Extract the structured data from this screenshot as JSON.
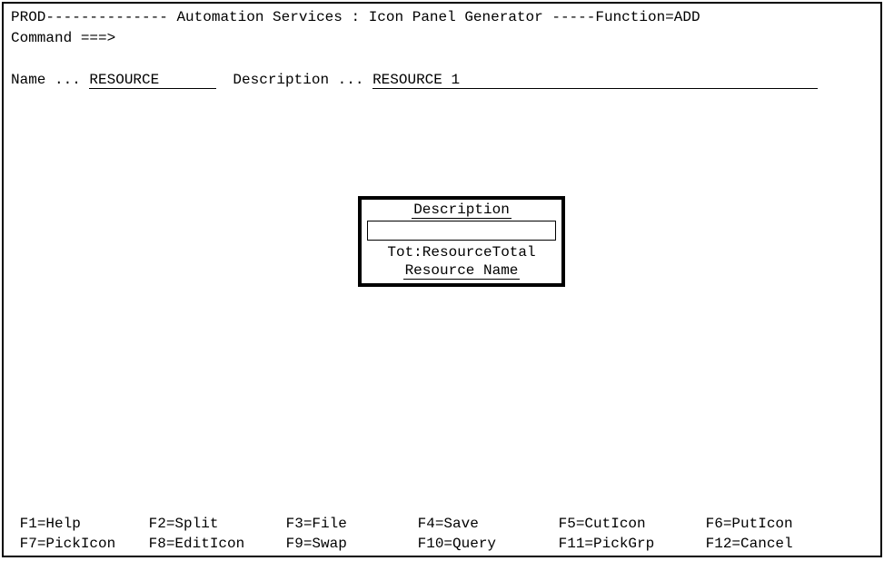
{
  "header": {
    "env": "PROD",
    "dashes1": "--------------",
    "title_left": "Automation Services",
    "sep": ":",
    "title_right": "Icon Panel Generator",
    "dashes2": "-----",
    "function_label": "Function=",
    "function_value": "ADD"
  },
  "command": {
    "label": "Command ===>",
    "value": ""
  },
  "fields": {
    "name_label": "Name ...",
    "name_value": "RESOURCE",
    "desc_label": "Description ...",
    "desc_value": "RESOURCE 1"
  },
  "icon_box": {
    "description_label": "Description",
    "tot_label": "Tot:",
    "tot_value": "ResourceTotal",
    "resource_name_label": "Resource Name"
  },
  "fkeys": {
    "f1": "F1=Help",
    "f2": "F2=Split",
    "f3": "F3=File",
    "f4": "F4=Save",
    "f5": "F5=CutIcon",
    "f6": "F6=PutIcon",
    "f7": "F7=PickIcon",
    "f8": "F8=EditIcon",
    "f9": "F9=Swap",
    "f10": "F10=Query",
    "f11": "F11=PickGrp",
    "f12": "F12=Cancel"
  }
}
